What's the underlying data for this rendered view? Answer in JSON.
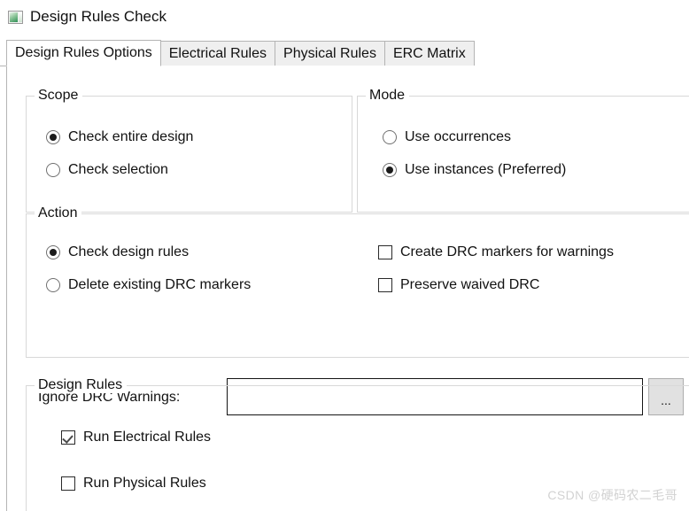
{
  "window": {
    "title": "Design Rules Check",
    "icon": "design-rules-check-icon"
  },
  "tabs": [
    {
      "label": "Design Rules Options",
      "active": true
    },
    {
      "label": "Electrical Rules",
      "active": false
    },
    {
      "label": "Physical Rules",
      "active": false
    },
    {
      "label": "ERC Matrix",
      "active": false
    }
  ],
  "scope": {
    "title": "Scope",
    "options": [
      {
        "label": "Check entire design",
        "selected": true
      },
      {
        "label": "Check selection",
        "selected": false
      }
    ]
  },
  "mode": {
    "title": "Mode",
    "options": [
      {
        "label": "Use occurrences",
        "selected": false
      },
      {
        "label": "Use instances (Preferred)",
        "selected": true
      }
    ]
  },
  "action": {
    "title": "Action",
    "radios": [
      {
        "label": "Check design rules",
        "selected": true
      },
      {
        "label": "Delete existing DRC markers",
        "selected": false
      }
    ],
    "checkboxes": [
      {
        "label": "Create DRC markers for warnings",
        "checked": false
      },
      {
        "label": "Preserve waived DRC",
        "checked": false
      }
    ],
    "ignore_warnings": {
      "label": "Ignore DRC Warnings:",
      "value": "",
      "placeholder": "",
      "browse_label": "..."
    }
  },
  "design_rules": {
    "title": "Design Rules",
    "checkboxes": [
      {
        "label": "Run Electrical Rules",
        "checked": true
      },
      {
        "label": "Run Physical Rules",
        "checked": false
      }
    ]
  },
  "watermark": {
    "text": "CSDN @硬码农二毛哥"
  },
  "colors": {
    "window_bg": "#ffffff",
    "tab_inactive_bg": "#efefef",
    "tab_border": "#b4b4b4",
    "group_border": "#d8d8d8",
    "text": "#111111",
    "button_bg": "#e1e1e1",
    "watermark": "#d2d2d2"
  }
}
